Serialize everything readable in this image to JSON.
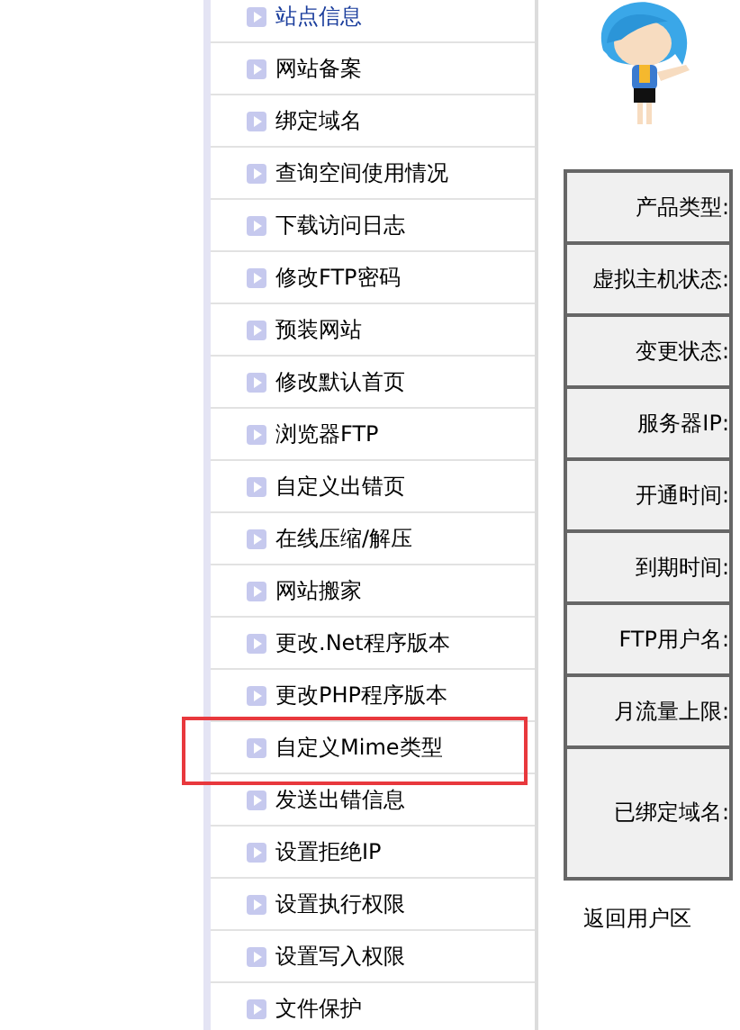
{
  "sidebar": {
    "items": [
      {
        "label": "站点信息",
        "selected": true,
        "highlighted": false
      },
      {
        "label": "网站备案",
        "selected": false,
        "highlighted": false
      },
      {
        "label": "绑定域名",
        "selected": false,
        "highlighted": false
      },
      {
        "label": "查询空间使用情况",
        "selected": false,
        "highlighted": false
      },
      {
        "label": "下载访问日志",
        "selected": false,
        "highlighted": false
      },
      {
        "label": "修改FTP密码",
        "selected": false,
        "highlighted": false
      },
      {
        "label": "预装网站",
        "selected": false,
        "highlighted": false
      },
      {
        "label": "修改默认首页",
        "selected": false,
        "highlighted": false
      },
      {
        "label": "浏览器FTP",
        "selected": false,
        "highlighted": false
      },
      {
        "label": "自定义出错页",
        "selected": false,
        "highlighted": false
      },
      {
        "label": "在线压缩/解压",
        "selected": false,
        "highlighted": false
      },
      {
        "label": "网站搬家",
        "selected": false,
        "highlighted": false
      },
      {
        "label": "更改.Net程序版本",
        "selected": false,
        "highlighted": false
      },
      {
        "label": "更改PHP程序版本",
        "selected": false,
        "highlighted": false
      },
      {
        "label": "自定义Mime类型",
        "selected": false,
        "highlighted": true
      },
      {
        "label": "发送出错信息",
        "selected": false,
        "highlighted": false
      },
      {
        "label": "设置拒绝IP",
        "selected": false,
        "highlighted": false
      },
      {
        "label": "设置执行权限",
        "selected": false,
        "highlighted": false
      },
      {
        "label": "设置写入权限",
        "selected": false,
        "highlighted": false
      },
      {
        "label": "文件保护",
        "selected": false,
        "highlighted": false
      }
    ]
  },
  "info_table": {
    "rows": [
      {
        "label": "产品类型:"
      },
      {
        "label": "虚拟主机状态:"
      },
      {
        "label": "变更状态:"
      },
      {
        "label": "服务器IP:"
      },
      {
        "label": "开通时间:"
      },
      {
        "label": "到期时间:"
      },
      {
        "label": "FTP用户名:"
      },
      {
        "label": "月流量上限:"
      },
      {
        "label": "已绑定域名:"
      }
    ]
  },
  "back_link": "返回用户区"
}
